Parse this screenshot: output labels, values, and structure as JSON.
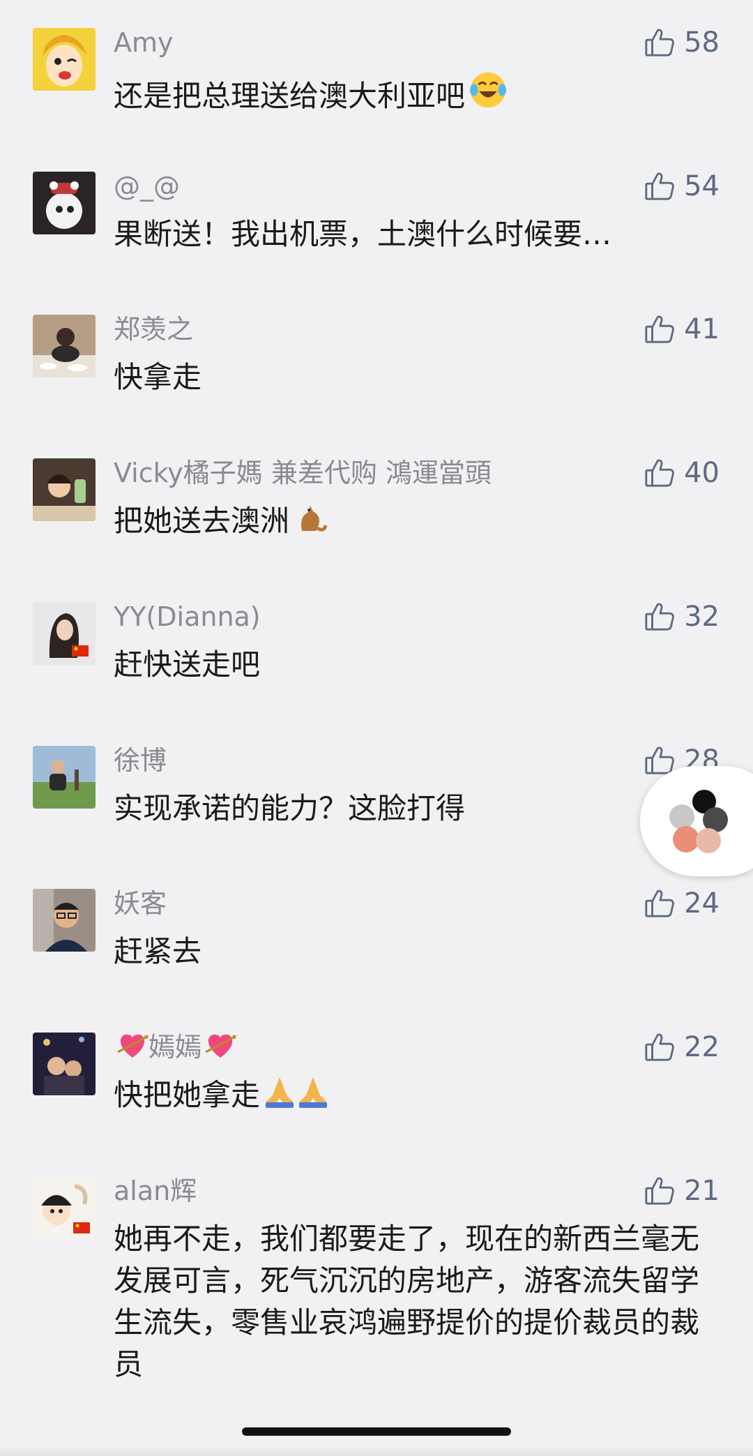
{
  "comments": [
    {
      "name": "Amy",
      "name_emoji": "",
      "text": "还是把总理送给澳大利亚吧",
      "text_emoji": "laughing-tears-emoji",
      "likes": "58",
      "avatar": "cartoon-girl-winking"
    },
    {
      "name": "@_@",
      "name_emoji": "",
      "text": "果断送！我出机票，土澳什么时候要…",
      "text_emoji": "",
      "likes": "54",
      "avatar": "toy-figure"
    },
    {
      "name": "郑羡之",
      "name_emoji": "",
      "text": "快拿走",
      "text_emoji": "",
      "likes": "41",
      "avatar": "woman-at-table"
    },
    {
      "name": "Vicky橘子媽 兼差代购 鴻運當頭",
      "name_emoji": "",
      "text": "把她送去澳洲",
      "text_emoji": "kangaroo-emoji",
      "likes": "40",
      "avatar": "girl-with-drink"
    },
    {
      "name": "YY(Dianna)",
      "name_emoji": "",
      "text": "赶快送走吧",
      "text_emoji": "",
      "likes": "32",
      "avatar": "woman-with-flag"
    },
    {
      "name": "徐博",
      "name_emoji": "",
      "text": "实现承诺的能力？这脸打得",
      "text_emoji": "",
      "likes": "28",
      "avatar": "man-on-grass"
    },
    {
      "name": "妖客",
      "name_emoji": "",
      "text": "赶紧去",
      "text_emoji": "",
      "likes": "24",
      "avatar": "man-with-glasses"
    },
    {
      "name": "嫣嫣",
      "name_emoji": "heart-arrow-emoji",
      "text": "快把她拿走",
      "text_emoji": "praying-hands-emoji",
      "likes": "22",
      "avatar": "family-night"
    },
    {
      "name": "alan辉",
      "name_emoji": "",
      "text": "她再不走，我们都要走了，现在的新西兰毫无发展可言，死气沉沉的房地产，游客流失留学生流失，零售业哀鸿遍野提价的提价裁员的裁员",
      "text_emoji": "",
      "likes": "21",
      "avatar": "cartoon-kid-with-flag"
    }
  ],
  "colors": {
    "background": "#f1f1f3",
    "name": "#8a8a8f",
    "text": "#1a1a1a",
    "like": "#5e6a82"
  }
}
